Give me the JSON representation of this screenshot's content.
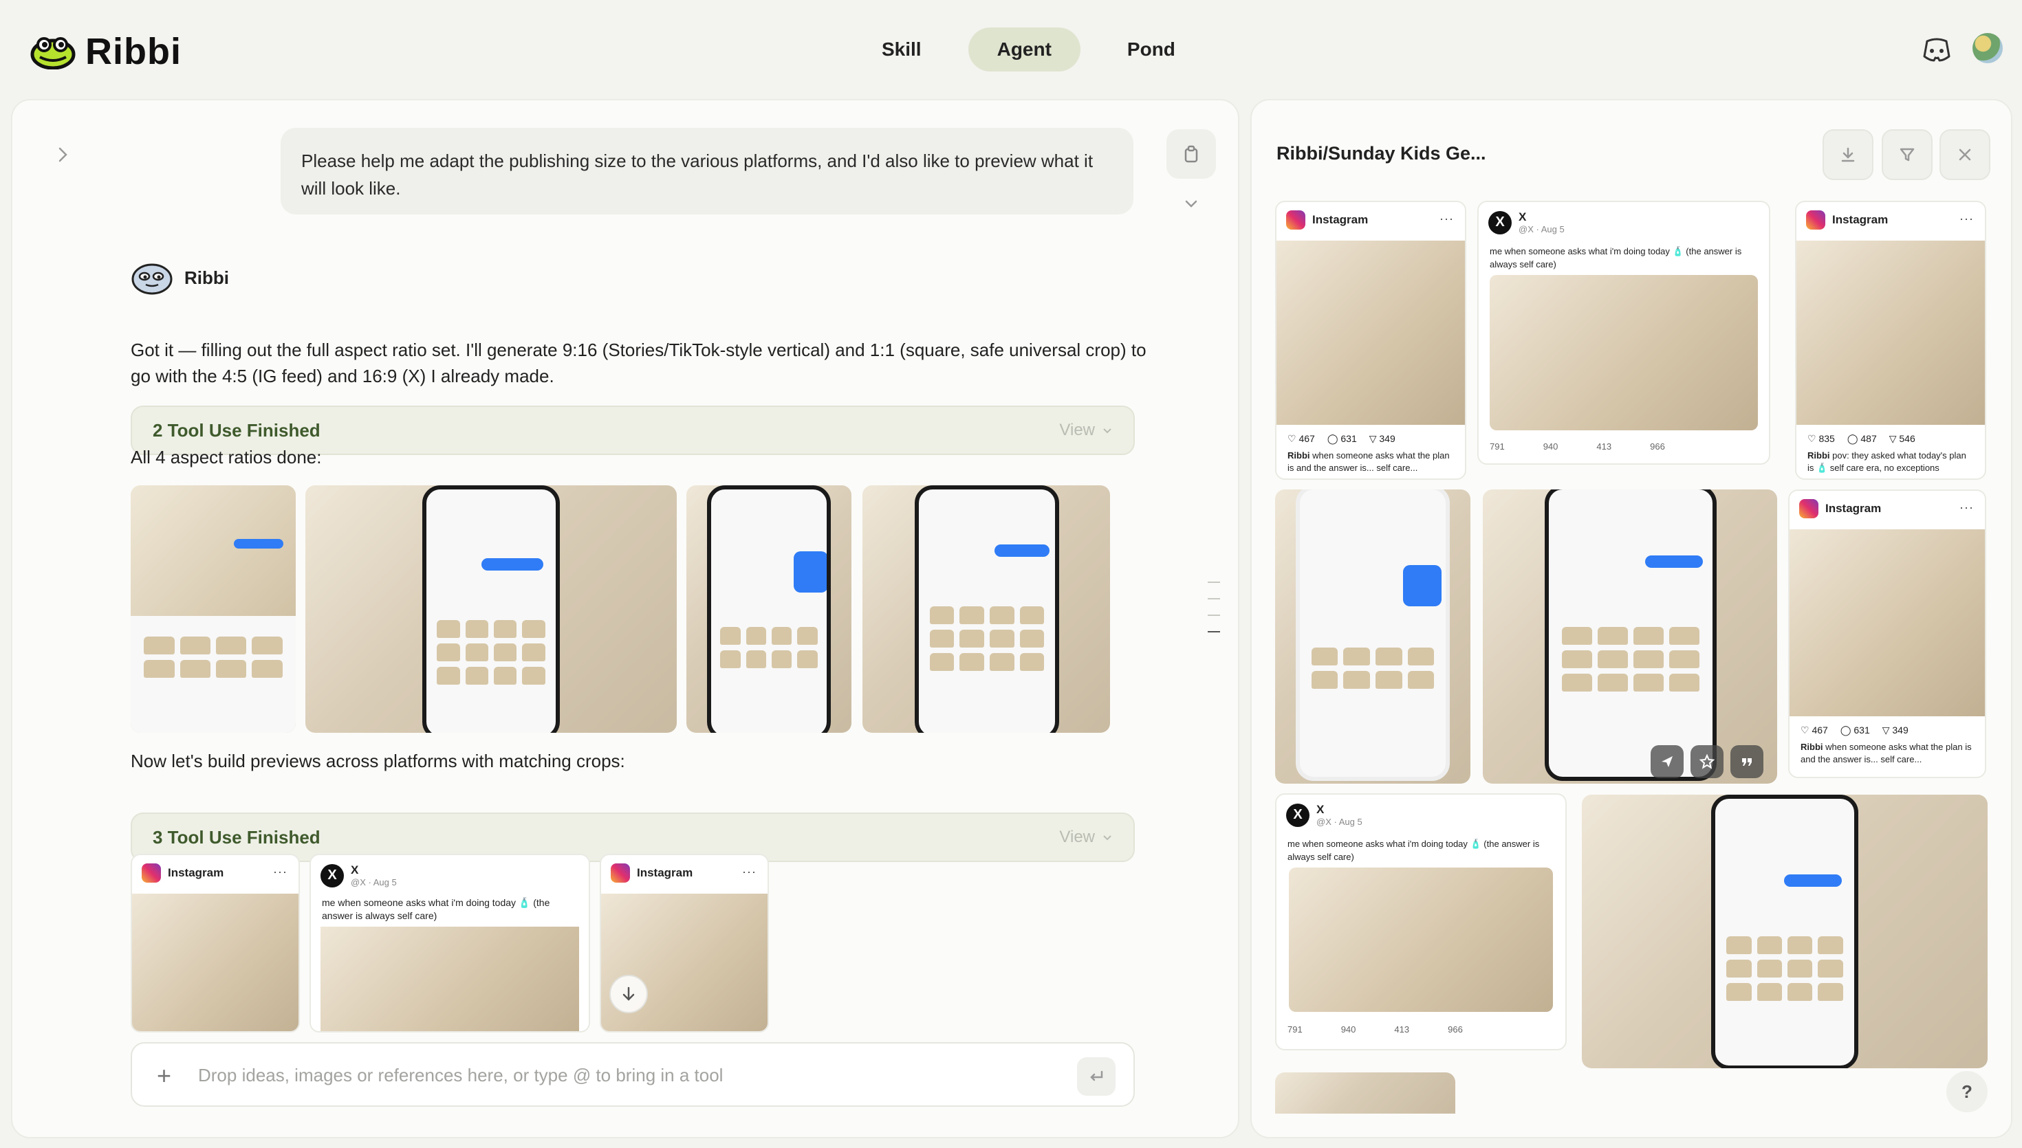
{
  "app": {
    "name": "Ribbi",
    "colors": {
      "accent": "#dfe4cf",
      "tool_text": "#3f5a2c",
      "logo_green": "#b6e22e"
    }
  },
  "nav": {
    "tabs": [
      {
        "label": "Skill"
      },
      {
        "label": "Agent"
      },
      {
        "label": "Pond"
      }
    ],
    "active": "Agent"
  },
  "chat": {
    "user_message": "Please help me adapt the publishing size to the various platforms, and I'd also like to preview what it will look like.",
    "bot_name": "Ribbi",
    "reply_1": "Got it — filling out the full aspect ratio set. I'll generate 9:16 (Stories/TikTok-style vertical) and 1:1 (square, safe universal crop) to go with the 4:5 (IG feed) and 16:9 (X) I already made.",
    "tool_box_1": {
      "label": "2 Tool Use Finished",
      "view": "View"
    },
    "reply_2": "All 4 aspect ratios done:",
    "reply_3": "Now let's build previews across platforms with matching crops:",
    "tool_box_2": {
      "label": "3 Tool Use Finished",
      "view": "View"
    },
    "preview_cards": [
      {
        "platform": "Instagram"
      },
      {
        "platform": "X",
        "handle": "@X · Aug 5",
        "text": "me when someone asks what i'm doing today 🧴 (the answer is always self care)"
      },
      {
        "platform": "Instagram"
      }
    ],
    "composer": {
      "placeholder": "Drop ideas, images or references here, or type @ to bring in a tool"
    }
  },
  "panel": {
    "title": "Ribbi/Sunday Kids Ge...",
    "icons": [
      "download-icon",
      "filter-icon",
      "close-icon"
    ],
    "cards": {
      "ig1": {
        "platform": "Instagram",
        "likes": "467",
        "comments": "631",
        "shares": "349",
        "user": "Ribbi",
        "caption": "when someone asks what the plan is and the answer is... self care..."
      },
      "x1": {
        "platform": "X",
        "handle": "@X · Aug 5",
        "text": "me when someone asks what i'm doing today 🧴 (the answer is always self care)",
        "replies": "791",
        "reposts": "940",
        "likes": "413",
        "views": "966"
      },
      "ig2": {
        "platform": "Instagram",
        "likes": "835",
        "comments": "487",
        "shares": "546",
        "user": "Ribbi",
        "caption": "pov: they asked what today's plan is 🧴 self care era, no exceptions"
      },
      "ig3": {
        "platform": "Instagram",
        "likes": "467",
        "comments": "631",
        "shares": "349",
        "user": "Ribbi",
        "caption": "when someone asks what the plan is and the answer is... self care..."
      },
      "x2": {
        "platform": "X",
        "handle": "@X · Aug 5",
        "text": "me when someone asks what i'm doing today 🧴 (the answer is always self care)",
        "replies": "791",
        "reposts": "940",
        "likes": "413",
        "views": "966"
      }
    },
    "help": "?"
  }
}
